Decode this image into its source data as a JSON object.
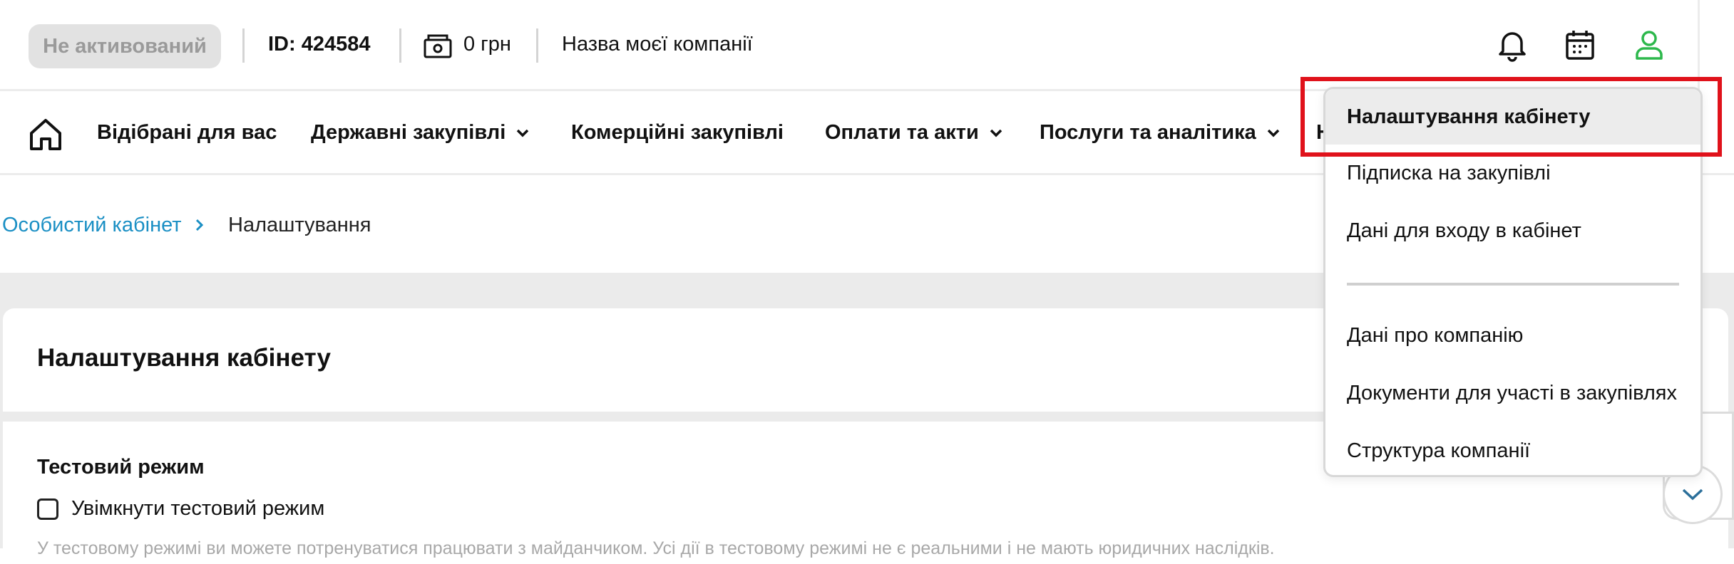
{
  "header": {
    "status_badge": "Не активований",
    "account_id": "ID: 424584",
    "balance": "0 грн",
    "company_name": "Назва моєї компанії"
  },
  "nav": {
    "items": [
      {
        "label": "Відібрані для вас",
        "has_dropdown": false
      },
      {
        "label": "Державні закупівлі",
        "has_dropdown": true
      },
      {
        "label": "Комерційні закупівлі",
        "has_dropdown": false
      },
      {
        "label": "Оплати та акти",
        "has_dropdown": true
      },
      {
        "label": "Послуги та аналітика",
        "has_dropdown": true
      },
      {
        "label": "Н",
        "has_dropdown": false
      }
    ]
  },
  "breadcrumb": {
    "parent": "Особистий кабінет",
    "current": "Налаштування"
  },
  "page": {
    "title": "Налаштування кабінету",
    "test_mode": {
      "title": "Тестовий режим",
      "checkbox_label": "Увімкнути тестовий режим",
      "checked": false,
      "note": "У тестовому режимі ви можете потренуватися працювати з майданчиком. Усі дії в тестовому режимі не є реальними і не мають юридичних наслідків."
    }
  },
  "dropdown": {
    "items_group1": [
      "Налаштування кабінету",
      "Підписка на закупівлі",
      "Дані для входу в кабінет"
    ],
    "items_group2": [
      "Дані про компанію",
      "Документи для участі в закупівлях",
      "Структура компанії"
    ],
    "active_item": "Налаштування кабінету"
  },
  "icons": {
    "balance": "money-icon",
    "notifications": "bell-icon",
    "calendar": "calendar-icon",
    "profile": "user-icon",
    "home": "home-icon"
  },
  "colors": {
    "accent_green": "#2db84c",
    "link_blue": "#1a8fc4",
    "highlight_red": "#e0121b",
    "badge_bg": "#e2e2e2"
  }
}
